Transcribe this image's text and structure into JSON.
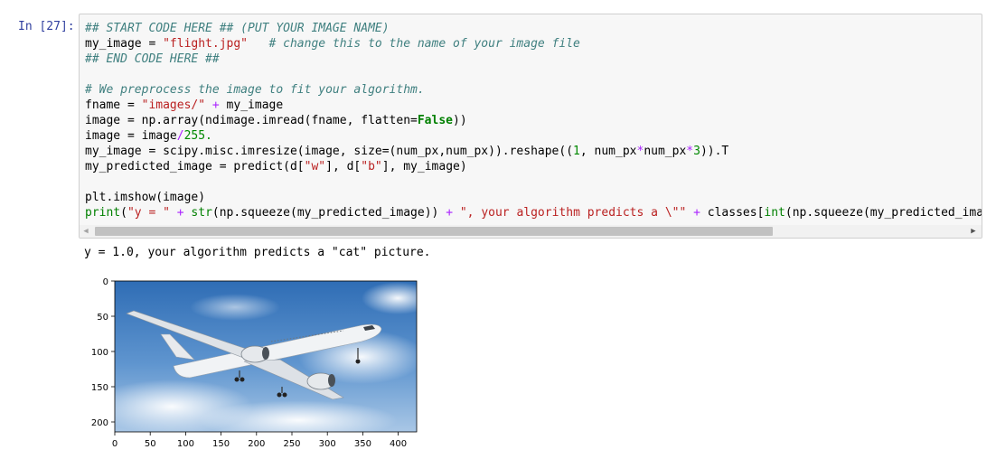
{
  "cell": {
    "prompt": "In [27]:",
    "code_lines": [
      [
        {
          "t": "## START CODE HERE ## (PUT YOUR IMAGE NAME)",
          "c": "c"
        }
      ],
      [
        {
          "t": "my_image = ",
          "c": ""
        },
        {
          "t": "\"flight.jpg\"",
          "c": "s"
        },
        {
          "t": "   ",
          "c": ""
        },
        {
          "t": "# change this to the name of your image file",
          "c": "c"
        }
      ],
      [
        {
          "t": "## END CODE HERE ##",
          "c": "c"
        }
      ],
      [
        {
          "t": "",
          "c": ""
        }
      ],
      [
        {
          "t": "# We preprocess the image to fit your algorithm.",
          "c": "c"
        }
      ],
      [
        {
          "t": "fname = ",
          "c": ""
        },
        {
          "t": "\"images/\"",
          "c": "s"
        },
        {
          "t": " ",
          "c": ""
        },
        {
          "t": "+",
          "c": "o"
        },
        {
          "t": " my_image",
          "c": ""
        }
      ],
      [
        {
          "t": "image = np.array(ndimage.imread(fname, flatten=",
          "c": ""
        },
        {
          "t": "False",
          "c": "k"
        },
        {
          "t": "))",
          "c": ""
        }
      ],
      [
        {
          "t": "image = image",
          "c": ""
        },
        {
          "t": "/",
          "c": "o"
        },
        {
          "t": "255.",
          "c": "m"
        }
      ],
      [
        {
          "t": "my_image = scipy.misc.imresize(image, size=(num_px,num_px)).reshape((",
          "c": ""
        },
        {
          "t": "1",
          "c": "m"
        },
        {
          "t": ", num_px",
          "c": ""
        },
        {
          "t": "*",
          "c": "o"
        },
        {
          "t": "num_px",
          "c": ""
        },
        {
          "t": "*",
          "c": "o"
        },
        {
          "t": "3",
          "c": "m"
        },
        {
          "t": ")).T",
          "c": ""
        }
      ],
      [
        {
          "t": "my_predicted_image = predict(d[",
          "c": ""
        },
        {
          "t": "\"w\"",
          "c": "s"
        },
        {
          "t": "], d[",
          "c": ""
        },
        {
          "t": "\"b\"",
          "c": "s"
        },
        {
          "t": "], my_image)",
          "c": ""
        }
      ],
      [
        {
          "t": "",
          "c": ""
        }
      ],
      [
        {
          "t": "plt.imshow(image)",
          "c": ""
        }
      ],
      [
        {
          "t": "print",
          "c": "b"
        },
        {
          "t": "(",
          "c": ""
        },
        {
          "t": "\"y = \"",
          "c": "s"
        },
        {
          "t": " ",
          "c": ""
        },
        {
          "t": "+",
          "c": "o"
        },
        {
          "t": " ",
          "c": ""
        },
        {
          "t": "str",
          "c": "b"
        },
        {
          "t": "(np.squeeze(my_predicted_image)) ",
          "c": ""
        },
        {
          "t": "+",
          "c": "o"
        },
        {
          "t": " ",
          "c": ""
        },
        {
          "t": "\", your algorithm predicts a \\\"\"",
          "c": "s"
        },
        {
          "t": " ",
          "c": ""
        },
        {
          "t": "+",
          "c": "o"
        },
        {
          "t": " classes[",
          "c": ""
        },
        {
          "t": "int",
          "c": "b"
        },
        {
          "t": "(np.squeeze(my_predicted_image",
          "c": ""
        }
      ]
    ]
  },
  "output": {
    "text": "y = 1.0, your algorithm predicts a \"cat\" picture."
  },
  "plot": {
    "y_ticks": [
      "0",
      "50",
      "100",
      "150",
      "200"
    ],
    "x_ticks": [
      "0",
      "50",
      "100",
      "150",
      "200",
      "250",
      "300",
      "350",
      "400"
    ],
    "image_subject": "airplane-photo"
  },
  "colors": {
    "prompt": "#303F9F",
    "comment": "#408080",
    "string": "#BA2121",
    "keyword": "#008000",
    "operator": "#AA22FF"
  }
}
